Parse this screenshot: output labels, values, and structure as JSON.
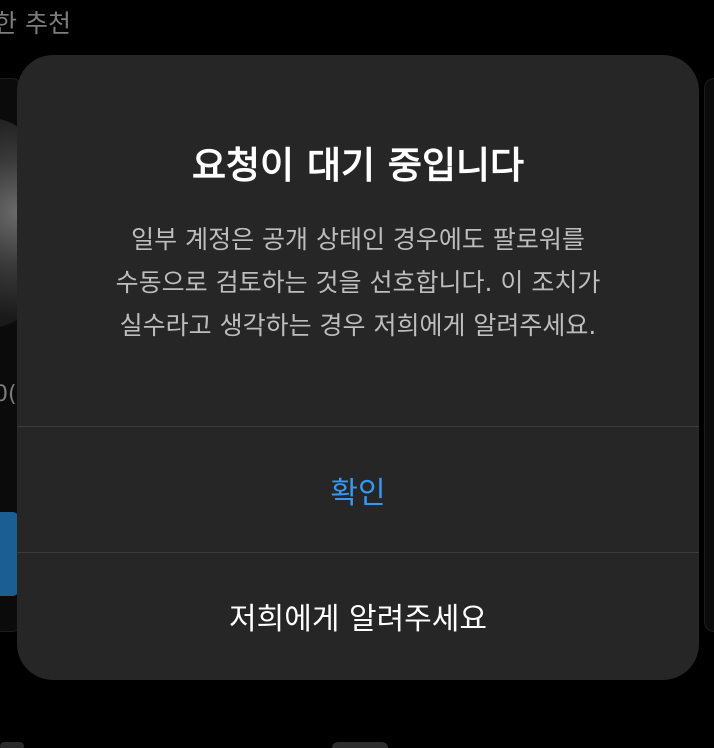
{
  "background": {
    "section_heading": "한 추천",
    "count_fragment": "0("
  },
  "dialog": {
    "title": "요청이 대기 중입니다",
    "message_lines": [
      "일부 계정은 공개 상태인 경우에도 팔로워를",
      "수동으로 검토하는 것을 선호합니다. 이 조치가",
      "실수라고 생각하는 경우 저희에게 알려주세요."
    ],
    "confirm_label": "확인",
    "report_label": "저희에게 알려주세요"
  },
  "colors": {
    "dialog_bg": "#262626",
    "confirm_text": "#3897f0",
    "primary_text": "#ffffff",
    "secondary_text": "#bdbdbd",
    "follow_button": "#1a5e93"
  }
}
